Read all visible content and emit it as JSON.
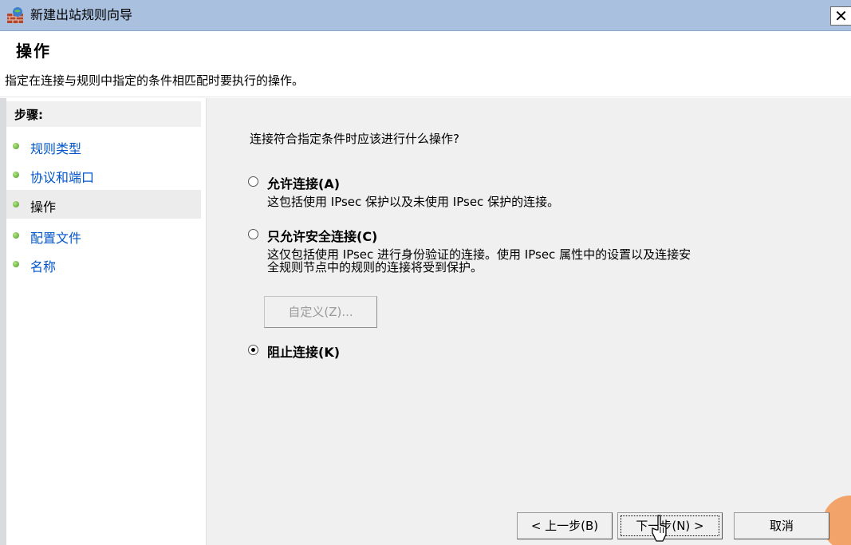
{
  "window": {
    "title": "新建出站规则向导",
    "close_glyph": "✕"
  },
  "header": {
    "heading": "操作",
    "description": "指定在连接与规则中指定的条件相匹配时要执行的操作。"
  },
  "steps": {
    "title": "步骤:",
    "items": [
      {
        "label": "规则类型",
        "current": false
      },
      {
        "label": "协议和端口",
        "current": false
      },
      {
        "label": "操作",
        "current": true
      },
      {
        "label": "配置文件",
        "current": false
      },
      {
        "label": "名称",
        "current": false
      }
    ]
  },
  "main": {
    "question": "连接符合指定条件时应该进行什么操作?",
    "options": [
      {
        "label": "允许连接(A)",
        "desc_lines": [
          "这包括使用 IPsec 保护以及未使用 IPsec 保护的连接。"
        ],
        "checked": false
      },
      {
        "label": "只允许安全连接(C)",
        "desc_lines": [
          "这仅包括使用 IPsec 进行身份验证的连接。使用 IPsec 属性中的设置以及连接安",
          "全规则节点中的规则的连接将受到保护。"
        ],
        "checked": false
      },
      {
        "label": "阻止连接(K)",
        "desc_lines": [],
        "checked": true
      }
    ],
    "customize_label": "自定义(Z)..."
  },
  "footer": {
    "back_label": "< 上一步(B)",
    "next_label": "下一步(N) >",
    "cancel_label": "取消"
  },
  "colors": {
    "titlebar": "#a9c1df",
    "link": "#0055cc",
    "step_dot": "#4b9a1f",
    "content_bg": "#f0f0f0"
  },
  "icons": {
    "title": "firewall-brick-icon",
    "cursor": "mouse-pointer-icon"
  }
}
